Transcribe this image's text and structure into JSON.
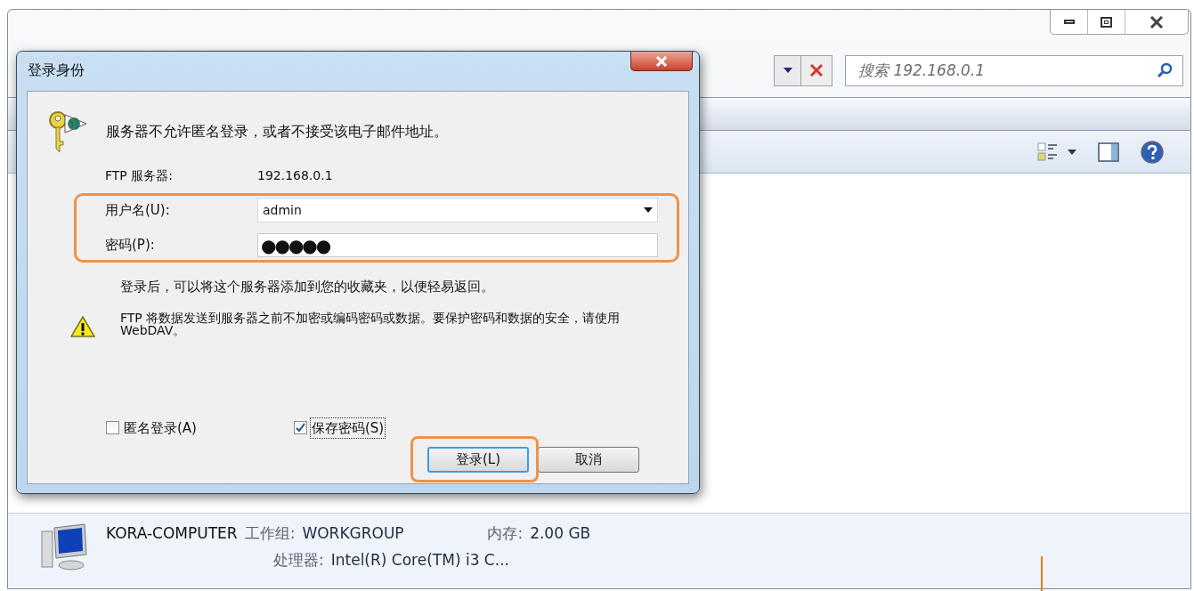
{
  "explorer": {
    "search": {
      "placeholder": "搜索 192.168.0.1"
    },
    "details": {
      "name": "KORA-COMPUTER",
      "fields": [
        {
          "label": "工作组:",
          "value": "WORKGROUP"
        },
        {
          "label": "内存:",
          "value": "2.00 GB"
        },
        {
          "label": "处理器:",
          "value": "Intel(R) Core(TM) i3 C..."
        }
      ]
    }
  },
  "dialog": {
    "title": "登录身份",
    "message": "服务器不允许匿名登录，或者不接受该电子邮件地址。",
    "server_label": "FTP 服务器:",
    "server_value": "192.168.0.1",
    "username_label": "用户名(U):",
    "username": "admin",
    "password_label": "密码(P):",
    "password_mask": "●●●●●",
    "note": "登录后，可以将这个服务器添加到您的收藏夹，以便轻易返回。",
    "warning": "FTP 将数据发送到服务器之前不加密或编码密码或数据。要保护密码和数据的安全，请使用 WebDAV。",
    "checkboxes": [
      {
        "label": "匿名登录(A)",
        "checked": false,
        "focused": false
      },
      {
        "label": "保存密码(S)",
        "checked": true,
        "focused": true
      }
    ],
    "buttons": [
      {
        "label": "登录(L)",
        "default": true
      },
      {
        "label": "取消",
        "default": false
      }
    ]
  }
}
